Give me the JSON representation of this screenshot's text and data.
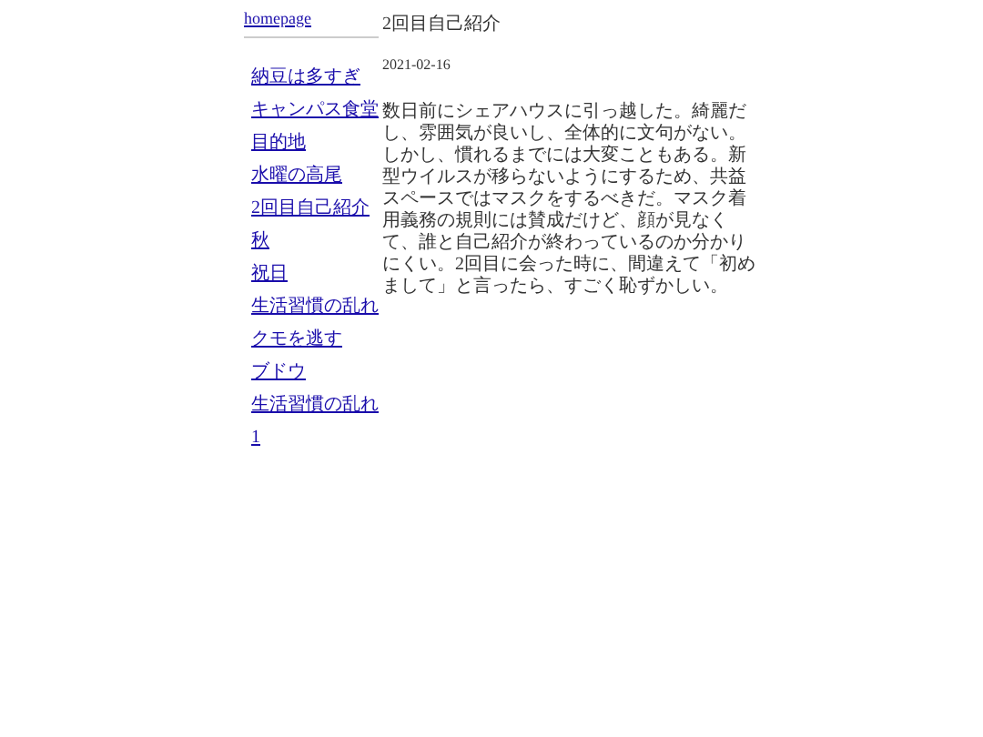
{
  "sidebar": {
    "home_link": "homepage",
    "links": [
      "納豆は多すぎ",
      "キャンパス食堂",
      "目的地",
      "水曜の高尾",
      "2回目自己紹介",
      "秋",
      "祝日",
      "生活習慣の乱れ",
      "クモを逃す",
      "ブドウ",
      "生活習慣の乱れ",
      "1"
    ]
  },
  "post": {
    "title": "2回目自己紹介",
    "date": "2021-02-16",
    "body": "数日前にシェアハウスに引っ越した。綺麗だし、雰囲気が良いし、全体的に文句がない。しかし、慣れるまでには大変こともある。新型ウイルスが移らないようにするため、共益スペースではマスクをするべきだ。マスク着用義務の規則には賛成だけど、顔が見なくて、誰と自己紹介が終わっているのか分かりにくい。2回目に会った時に、間違えて「初めまして」と言ったら、すごく恥ずかしい。"
  }
}
